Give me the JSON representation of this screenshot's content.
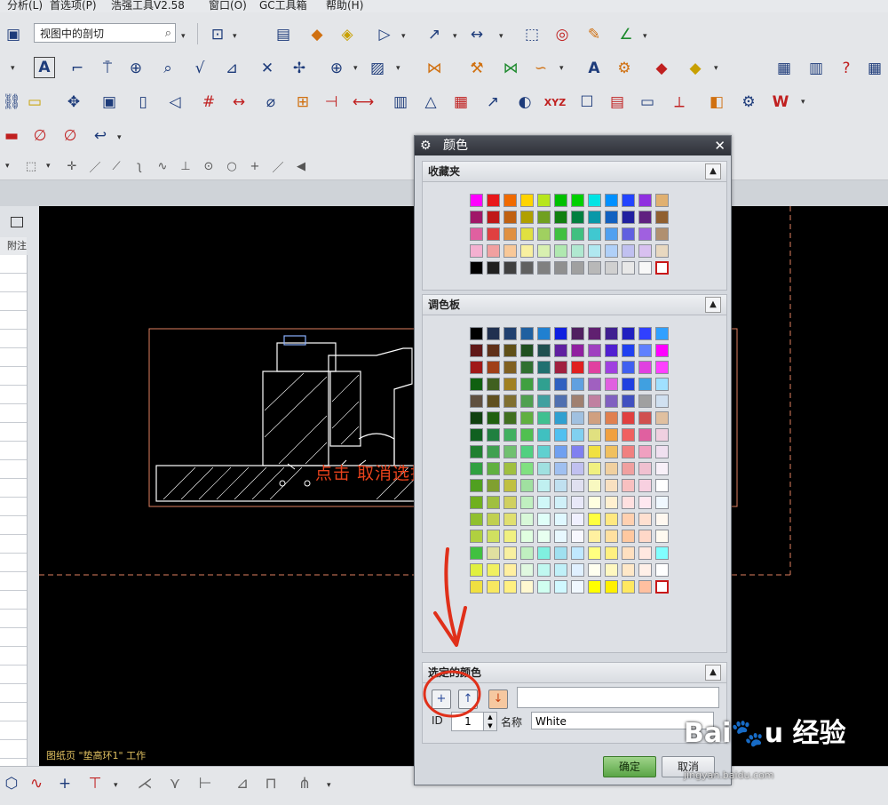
{
  "menu": [
    "分析(L)",
    "首选项(P)",
    "浩强工具V2.58",
    "窗口(O)",
    "GC工具箱",
    "帮助(H)"
  ],
  "toolbar": {
    "view_combo": "视图中的剖切"
  },
  "left_panel": {
    "column_header": "附注"
  },
  "canvas": {
    "status_text": "图纸页 \"垫高环1\" 工作",
    "annotation": "点击  取消选择所有颜色"
  },
  "dialog": {
    "title": "颜色",
    "favorites_label": "收藏夹",
    "palette_label": "调色板",
    "selected_label": "选定的颜色",
    "id_label": "ID",
    "id_value": "1",
    "name_label": "名称",
    "name_value": "White",
    "ok_label": "确定",
    "cancel_label": "取消",
    "close_glyph": "✕",
    "gear_glyph": "⚙",
    "caret_glyph": "▲"
  },
  "favorites_colors": [
    "#ff00ff",
    "#e8171a",
    "#f06a00",
    "#ffd400",
    "#b7e61c",
    "#00c000",
    "#00d000",
    "#00e4e4",
    "#0090ff",
    "#2244ff",
    "#9030e0",
    "#e0b070",
    "#a01868",
    "#c01818",
    "#c06010",
    "#b0a000",
    "#70a020",
    "#108010",
    "#008040",
    "#0898a8",
    "#1060c0",
    "#2020a0",
    "#602080",
    "#906030",
    "#e060a0",
    "#e04040",
    "#e09040",
    "#e0e040",
    "#a0d060",
    "#40c040",
    "#40c080",
    "#40c8d0",
    "#50a0f0",
    "#6060e0",
    "#a060e0",
    "#b09070",
    "#f4b0d0",
    "#f0a0a0",
    "#f8c898",
    "#f8f0a0",
    "#d8f0b0",
    "#b0e8b0",
    "#b0e8d0",
    "#b0e8f0",
    "#b0d0f8",
    "#c0c0f0",
    "#d8c0f0",
    "#e8d8c0",
    "#000000",
    "#202020",
    "#404040",
    "#606060",
    "#808080",
    "#909090",
    "#a0a0a0",
    "#b8b8b8",
    "#d0d0d0",
    "#e8e8e8",
    "#f8f8f8",
    "#ffffff"
  ],
  "palette_colors": [
    "#000000",
    "#203050",
    "#204070",
    "#2060a0",
    "#2080d0",
    "#1020e0",
    "#502060",
    "#602070",
    "#402090",
    "#2020c0",
    "#3040ff",
    "#30a0ff",
    "#601818",
    "#603018",
    "#605018",
    "#205020",
    "#205050",
    "#6020a0",
    "#9020a0",
    "#a040c0",
    "#5020d0",
    "#2040f0",
    "#6080ff",
    "#ff00ff",
    "#a01818",
    "#a04018",
    "#806020",
    "#307030",
    "#207070",
    "#a02040",
    "#e02020",
    "#e040a0",
    "#a040e0",
    "#4060f0",
    "#e040e0",
    "#ff40ff",
    "#106010",
    "#406020",
    "#a08020",
    "#40a040",
    "#30a090",
    "#3060c0",
    "#60a0e0",
    "#a060c0",
    "#e060e0",
    "#2040e0",
    "#40a0e0",
    "#a0e0ff",
    "#605040",
    "#605020",
    "#807030",
    "#50a050",
    "#40a0a0",
    "#5070b0",
    "#a08070",
    "#c080a0",
    "#8060c0",
    "#4050c0",
    "#a0a0a0",
    "#d0e0f0",
    "#104010",
    "#206010",
    "#407020",
    "#60b040",
    "#40c090",
    "#30a0d0",
    "#a0c0e0",
    "#d0a080",
    "#e08050",
    "#e04040",
    "#d05050",
    "#e0c0a0",
    "#106020",
    "#208040",
    "#40b060",
    "#50c050",
    "#40c0c0",
    "#50c0f0",
    "#80d0f0",
    "#e0e080",
    "#f0a040",
    "#f06060",
    "#e060a0",
    "#f0d0e0",
    "#208030",
    "#40a050",
    "#70c070",
    "#50d080",
    "#60d0d0",
    "#70a0f0",
    "#8080f0",
    "#f0e040",
    "#f0c060",
    "#f08080",
    "#f0a0c0",
    "#f0e0f0",
    "#30a040",
    "#60b040",
    "#a0c040",
    "#80e080",
    "#a0e0e0",
    "#a0c0f0",
    "#c0c0f0",
    "#f0f080",
    "#f0d0a0",
    "#f0a0a0",
    "#f0c0d0",
    "#f8f0f8",
    "#50a020",
    "#80a030",
    "#c0c040",
    "#a0e0a0",
    "#c0f0f0",
    "#c0e0f0",
    "#e0e0f0",
    "#f8f8c0",
    "#f8e0c0",
    "#f8c0c0",
    "#f8d0e0",
    "#ffffff",
    "#70b020",
    "#a0c040",
    "#d0d060",
    "#c0f0c0",
    "#d0f8f8",
    "#d0f0f8",
    "#e8e8f8",
    "#ffffe0",
    "#fff0d0",
    "#ffe0e0",
    "#ffe8f0",
    "#f0f8ff",
    "#90c030",
    "#c0d050",
    "#e0e070",
    "#d8f8d8",
    "#e0fff8",
    "#e0f8ff",
    "#f0f0ff",
    "#ffff40",
    "#ffe880",
    "#ffd0b0",
    "#ffe0d0",
    "#fff8f0",
    "#b0d040",
    "#d0e060",
    "#f0f080",
    "#e0ffe0",
    "#e8fff0",
    "#e8f8ff",
    "#f8f8ff",
    "#fff0a0",
    "#ffe0a0",
    "#ffc8a0",
    "#ffd8c8",
    "#fffaf0",
    "#40c040",
    "#e0e0a0",
    "#f8f0a0",
    "#c0f0c0",
    "#80f0e0",
    "#a0e0f0",
    "#c0e8ff",
    "#ffff80",
    "#fff080",
    "#ffe0c0",
    "#ffe8e0",
    "#80ffff",
    "#e0f040",
    "#f0f060",
    "#fff0a0",
    "#e0f8e0",
    "#c0f8f0",
    "#c0f0f8",
    "#e0f0ff",
    "#fffff0",
    "#fff8c0",
    "#ffe8c8",
    "#fff0e8",
    "#ffffff",
    "#f0e040",
    "#f8e860",
    "#fff080",
    "#fff8d0",
    "#d0fff0",
    "#d0f8ff",
    "#f0f8ff",
    "#ffff00",
    "#fff000",
    "#ffe860",
    "#ffc0a0",
    "#ffffff"
  ]
}
